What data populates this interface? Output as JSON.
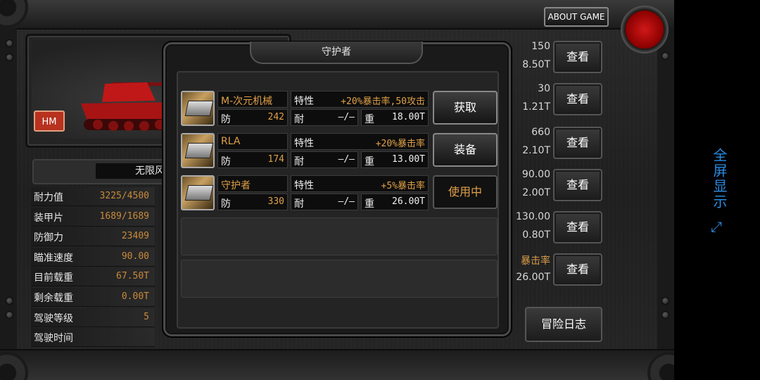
{
  "header": {
    "about_label": "ABOUT GAME"
  },
  "tank": {
    "badge": "HM"
  },
  "mode": {
    "label": "无限风"
  },
  "stats": [
    {
      "label": "耐力值",
      "value": "3225/4500"
    },
    {
      "label": "装甲片",
      "value": "1689/1689"
    },
    {
      "label": "防御力",
      "value": "23409"
    },
    {
      "label": "瞄准速度",
      "value": "90.00"
    },
    {
      "label": "目前载重",
      "value": "67.50T"
    },
    {
      "label": "剩余载重",
      "value": "0.00T"
    },
    {
      "label": "驾驶等级",
      "value": "5"
    },
    {
      "label": "驾驶时间",
      "value": ""
    }
  ],
  "right_rows": [
    {
      "top": "150",
      "bottom": "8.50T",
      "button": "查看"
    },
    {
      "top": "30",
      "bottom": "1.21T",
      "button": "查看"
    },
    {
      "top": "660",
      "bottom": "2.10T",
      "button": "查看"
    },
    {
      "top": "90.00",
      "bottom": "2.00T",
      "button": "查看"
    },
    {
      "top": "130.00",
      "bottom": "0.80T",
      "button": "查看"
    },
    {
      "top": "暴击率",
      "bottom": "26.00T",
      "button": "查看"
    }
  ],
  "log_button": "冒险日志",
  "modal": {
    "title": "守护者",
    "items": [
      {
        "name": "M-次元机械",
        "trait_label": "特性",
        "trait": "+20%暴击率,50攻击",
        "def_label": "防",
        "def": "242",
        "dur_label": "耐",
        "dur": "—/—",
        "weight_label": "重",
        "weight": "18.00T",
        "action": "获取",
        "action_state": "normal"
      },
      {
        "name": "RLA",
        "trait_label": "特性",
        "trait": "+20%暴击率",
        "def_label": "防",
        "def": "174",
        "dur_label": "耐",
        "dur": "—/—",
        "weight_label": "重",
        "weight": "13.00T",
        "action": "装备",
        "action_state": "normal"
      },
      {
        "name": "守护者",
        "trait_label": "特性",
        "trait": "+5%暴击率",
        "def_label": "防",
        "def": "330",
        "dur_label": "耐",
        "dur": "—/—",
        "weight_label": "重",
        "weight": "26.00T",
        "action": "使用中",
        "action_state": "inuse"
      }
    ]
  },
  "fullscreen": {
    "label": "全屏显示",
    "icon": "expand-icon"
  },
  "colors": {
    "accent_orange": "#e0a048",
    "hm_red": "#b7321f",
    "fullscreen_blue": "#2a8be0"
  }
}
